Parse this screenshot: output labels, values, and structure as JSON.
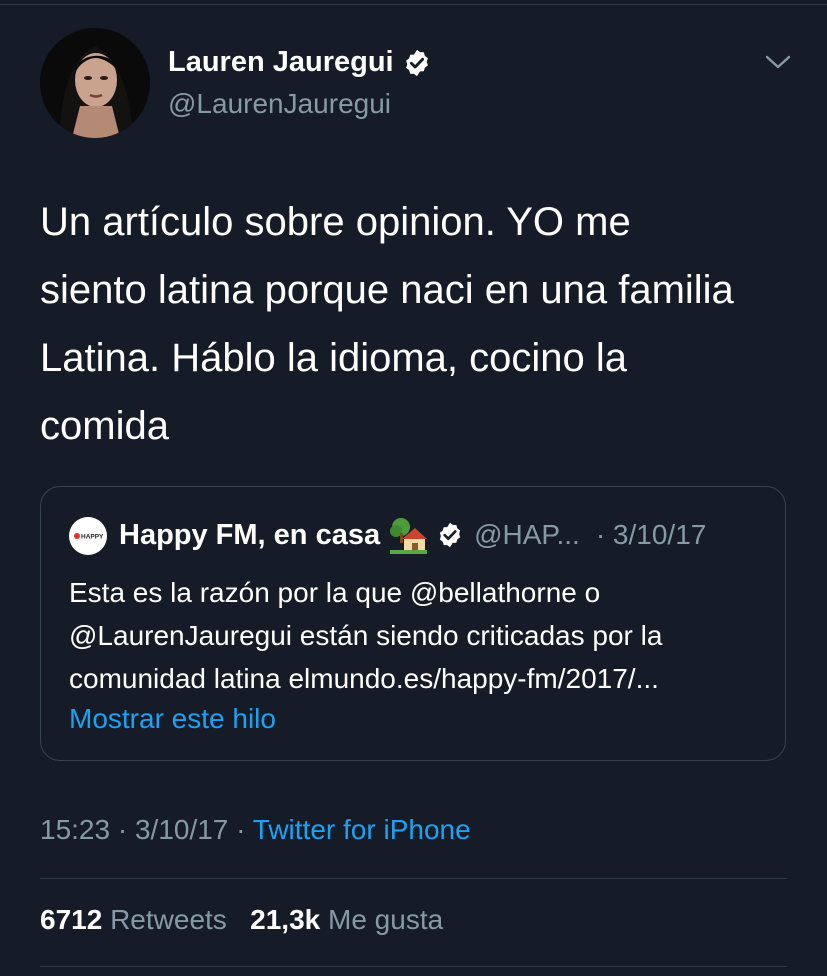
{
  "author": {
    "name": "Lauren Jauregui",
    "handle": "@LaurenJauregui",
    "verified": true
  },
  "tweet": {
    "lines": [
      "Un artículo sobre opinion. YO me",
      "siento latina porque naci en una familia",
      "Latina. Háblo la idioma, cocino la",
      "comida"
    ]
  },
  "quoted": {
    "avatar_text": "HAPPY",
    "name": "Happy FM, en casa",
    "emoji": "house-with-garden",
    "handle": "@HAP...",
    "date": "· 3/10/17",
    "lines": [
      "Esta es la razón por la que @bellathorne o",
      "@LaurenJauregui están siendo criticadas por la",
      "comunidad latina elmundo.es/happy-fm/2017/..."
    ],
    "thread_link": "Mostrar este hilo"
  },
  "meta": {
    "time": "15:23",
    "date": "· 3/10/17 ·",
    "source": "Twitter for iPhone"
  },
  "stats": {
    "retweets_count": "6712",
    "retweets_label": "Retweets",
    "likes_count": "21,3k",
    "likes_label": "Me gusta"
  },
  "colors": {
    "background": "#151c28",
    "text": "#ffffff",
    "secondary": "#8899a6",
    "link": "#1da1f2",
    "border": "#38444d"
  }
}
